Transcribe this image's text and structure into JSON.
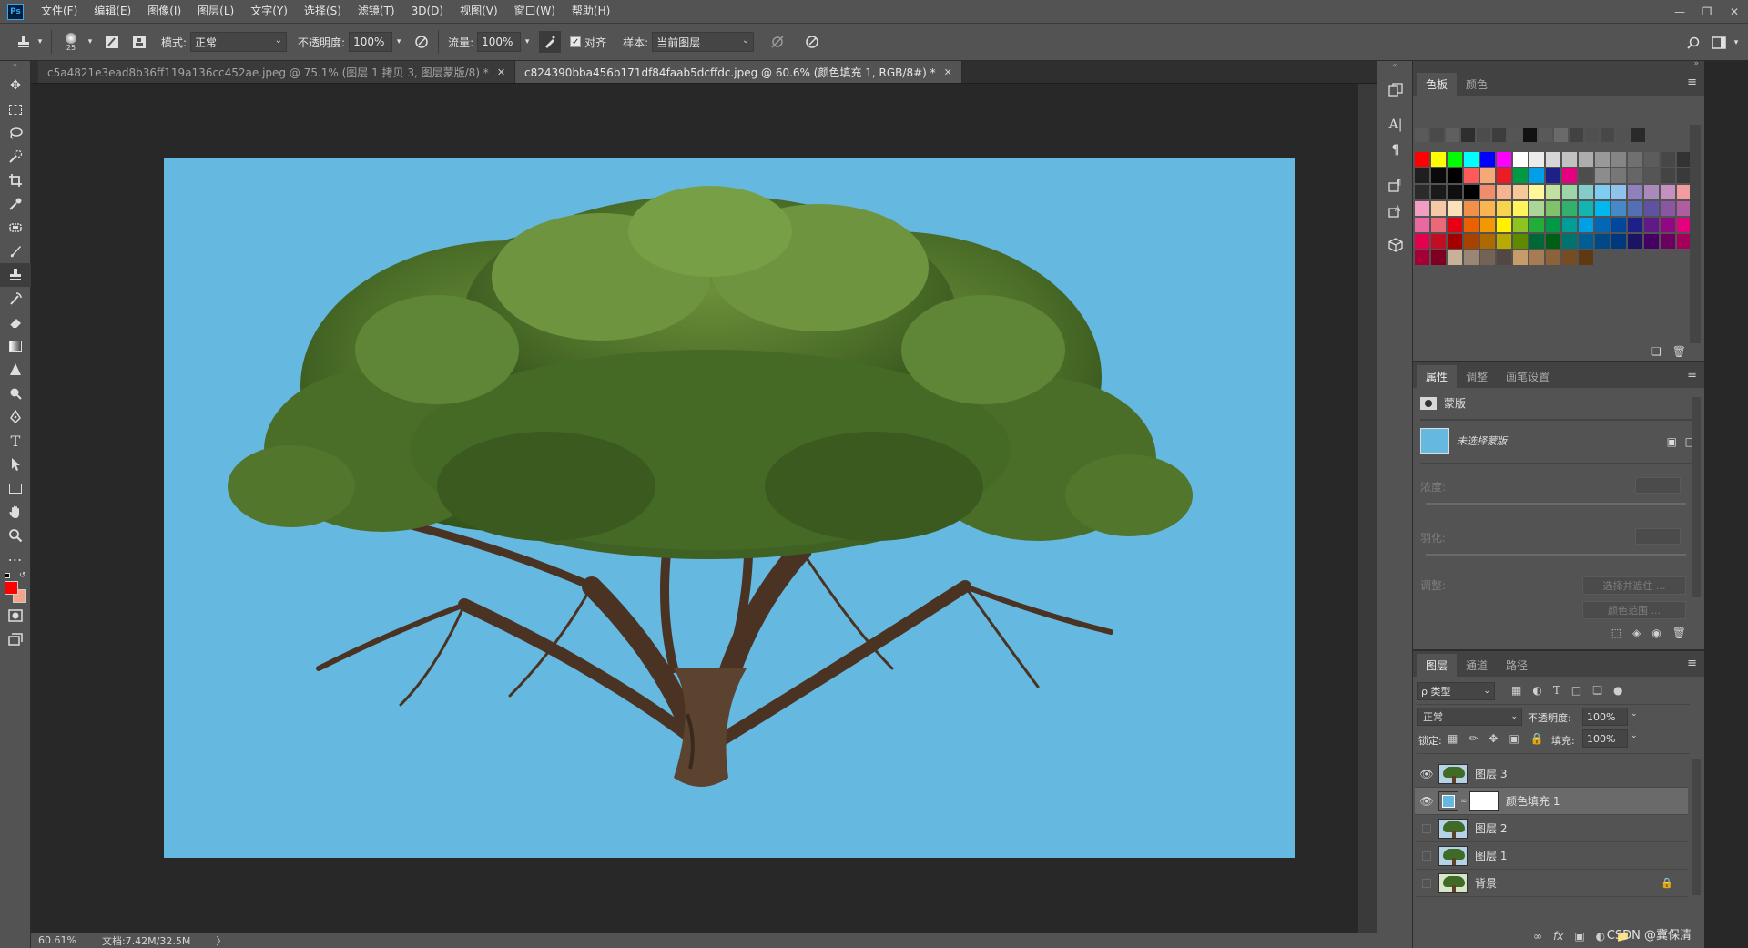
{
  "menu": {
    "logo": "Ps",
    "items": [
      "文件(F)",
      "编辑(E)",
      "图像(I)",
      "图层(L)",
      "文字(Y)",
      "选择(S)",
      "滤镜(T)",
      "3D(D)",
      "视图(V)",
      "窗口(W)",
      "帮助(H)"
    ]
  },
  "options": {
    "brush_size": "25",
    "mode_label": "模式:",
    "mode_value": "正常",
    "opacity_label": "不透明度:",
    "opacity_value": "100%",
    "flow_label": "流量:",
    "flow_value": "100%",
    "align_label": "对齐",
    "sample_label": "样本:",
    "sample_value": "当前图层"
  },
  "tabs": [
    {
      "label": "c5a4821e3ead8b36ff119a136cc452ae.jpeg @ 75.1% (图层 1 拷贝 3, 图层蒙版/8) *"
    },
    {
      "label": "c824390bba456b171df84faab5dcffdc.jpeg @ 60.6% (颜色填充 1, RGB/8#) *"
    }
  ],
  "status": {
    "zoom": "60.61%",
    "doc": "文档:7.42M/32.5M",
    "arrow": "〉"
  },
  "colors": {
    "foreground": "#ff0000",
    "background": "#f4a38a",
    "canvas_fill": "#65b8e0"
  },
  "swatches_panel": {
    "tabs": [
      "色板",
      "颜色"
    ],
    "recent": [
      "#5a5a5a",
      "#4a4a4a",
      "#5f5f5f",
      "#2e2e2e",
      "#4c4c4c",
      "#3d3d3d",
      "#555555",
      "#111111",
      "#595959",
      "#6a6a6a",
      "#424242",
      "#505050",
      "#484848",
      "#525252",
      "#2a2a2a"
    ],
    "grid": [
      "#ff0000",
      "#ffff00",
      "#00ff00",
      "#00ffff",
      "#0000ff",
      "#ff00ff",
      "#ffffff",
      "#ebebeb",
      "#d6d6d6",
      "#c2c2c2",
      "#adadad",
      "#999999",
      "#858585",
      "#707070",
      "#5c5c5c",
      "#474747",
      "#333333",
      "#1f1f1f",
      "#0a0a0a",
      "#000000",
      "#ff5a5a",
      "#f7a878",
      "#ed1c24",
      "#009944",
      "#00a0e9",
      "#1d2088",
      "#e4007f",
      "#4d4d4d",
      "#8c8c8c",
      "#777777",
      "#666666",
      "#555555",
      "#444444",
      "#3a3a3a",
      "#2b2b2b",
      "#1a1a1a",
      "#0f0f0f",
      "#000000",
      "#ef8c6c",
      "#f6b391",
      "#f7c99a",
      "#fff799",
      "#c2e0a0",
      "#9dd4a8",
      "#84ccc9",
      "#7ecef4",
      "#8fc3eb",
      "#8f82bc",
      "#aa89bd",
      "#c490bf",
      "#f29c9f",
      "#f19ec2",
      "#f6c8a8",
      "#fce0b9",
      "#f19149",
      "#f8b551",
      "#f8d34e",
      "#fff45c",
      "#acd598",
      "#80c269",
      "#32b16c",
      "#13b5b1",
      "#00b7ee",
      "#448aca",
      "#556fb5",
      "#5f52a0",
      "#8957a1",
      "#ae5da1",
      "#ea68a2",
      "#eb6877",
      "#e60012",
      "#eb6100",
      "#f39800",
      "#fff100",
      "#8fc31f",
      "#22ac38",
      "#009944",
      "#009e96",
      "#00a0e9",
      "#0068b7",
      "#00479d",
      "#1d2088",
      "#601986",
      "#920783",
      "#e4007f",
      "#e5004f",
      "#c30d23",
      "#a40000",
      "#a84200",
      "#ac6a00",
      "#b7aa00",
      "#5f8a00",
      "#006837",
      "#005e15",
      "#00736d",
      "#005e96",
      "#004986",
      "#00387d",
      "#1b1464",
      "#440062",
      "#6a005f",
      "#a4005b",
      "#a40035",
      "#7d0022",
      "#c7b299",
      "#998675",
      "#736357",
      "#534741",
      "#c69c6d",
      "#a67c52",
      "#8c6239",
      "#754c24",
      "#603913"
    ]
  },
  "properties_panel": {
    "tabs": [
      "属性",
      "调整",
      "画笔设置"
    ],
    "section": "蒙版",
    "mask_status": "未选择蒙版",
    "density_label": "浓度:",
    "feather_label": "羽化:",
    "adjust_label": "调整:",
    "select_mask_btn": "选择并遮住 ...",
    "color_range_btn": "颜色范围 ..."
  },
  "layers_panel": {
    "tabs": [
      "图层",
      "通道",
      "路径"
    ],
    "filter_label": "ρ 类型",
    "blend_mode": "正常",
    "opacity_label": "不透明度:",
    "opacity_value": "100%",
    "lock_label": "锁定:",
    "fill_label": "填充:",
    "fill_value": "100%",
    "layers": [
      {
        "name": "图层 3",
        "visible": true,
        "selected": false,
        "type": "image"
      },
      {
        "name": "颜色填充 1",
        "visible": true,
        "selected": true,
        "type": "fill"
      },
      {
        "name": "图层 2",
        "visible": false,
        "selected": false,
        "type": "image"
      },
      {
        "name": "图层 1",
        "visible": false,
        "selected": false,
        "type": "image"
      },
      {
        "name": "背景",
        "visible": false,
        "selected": false,
        "type": "image",
        "locked": true
      }
    ],
    "watermark": "CSDN @冀保清"
  }
}
